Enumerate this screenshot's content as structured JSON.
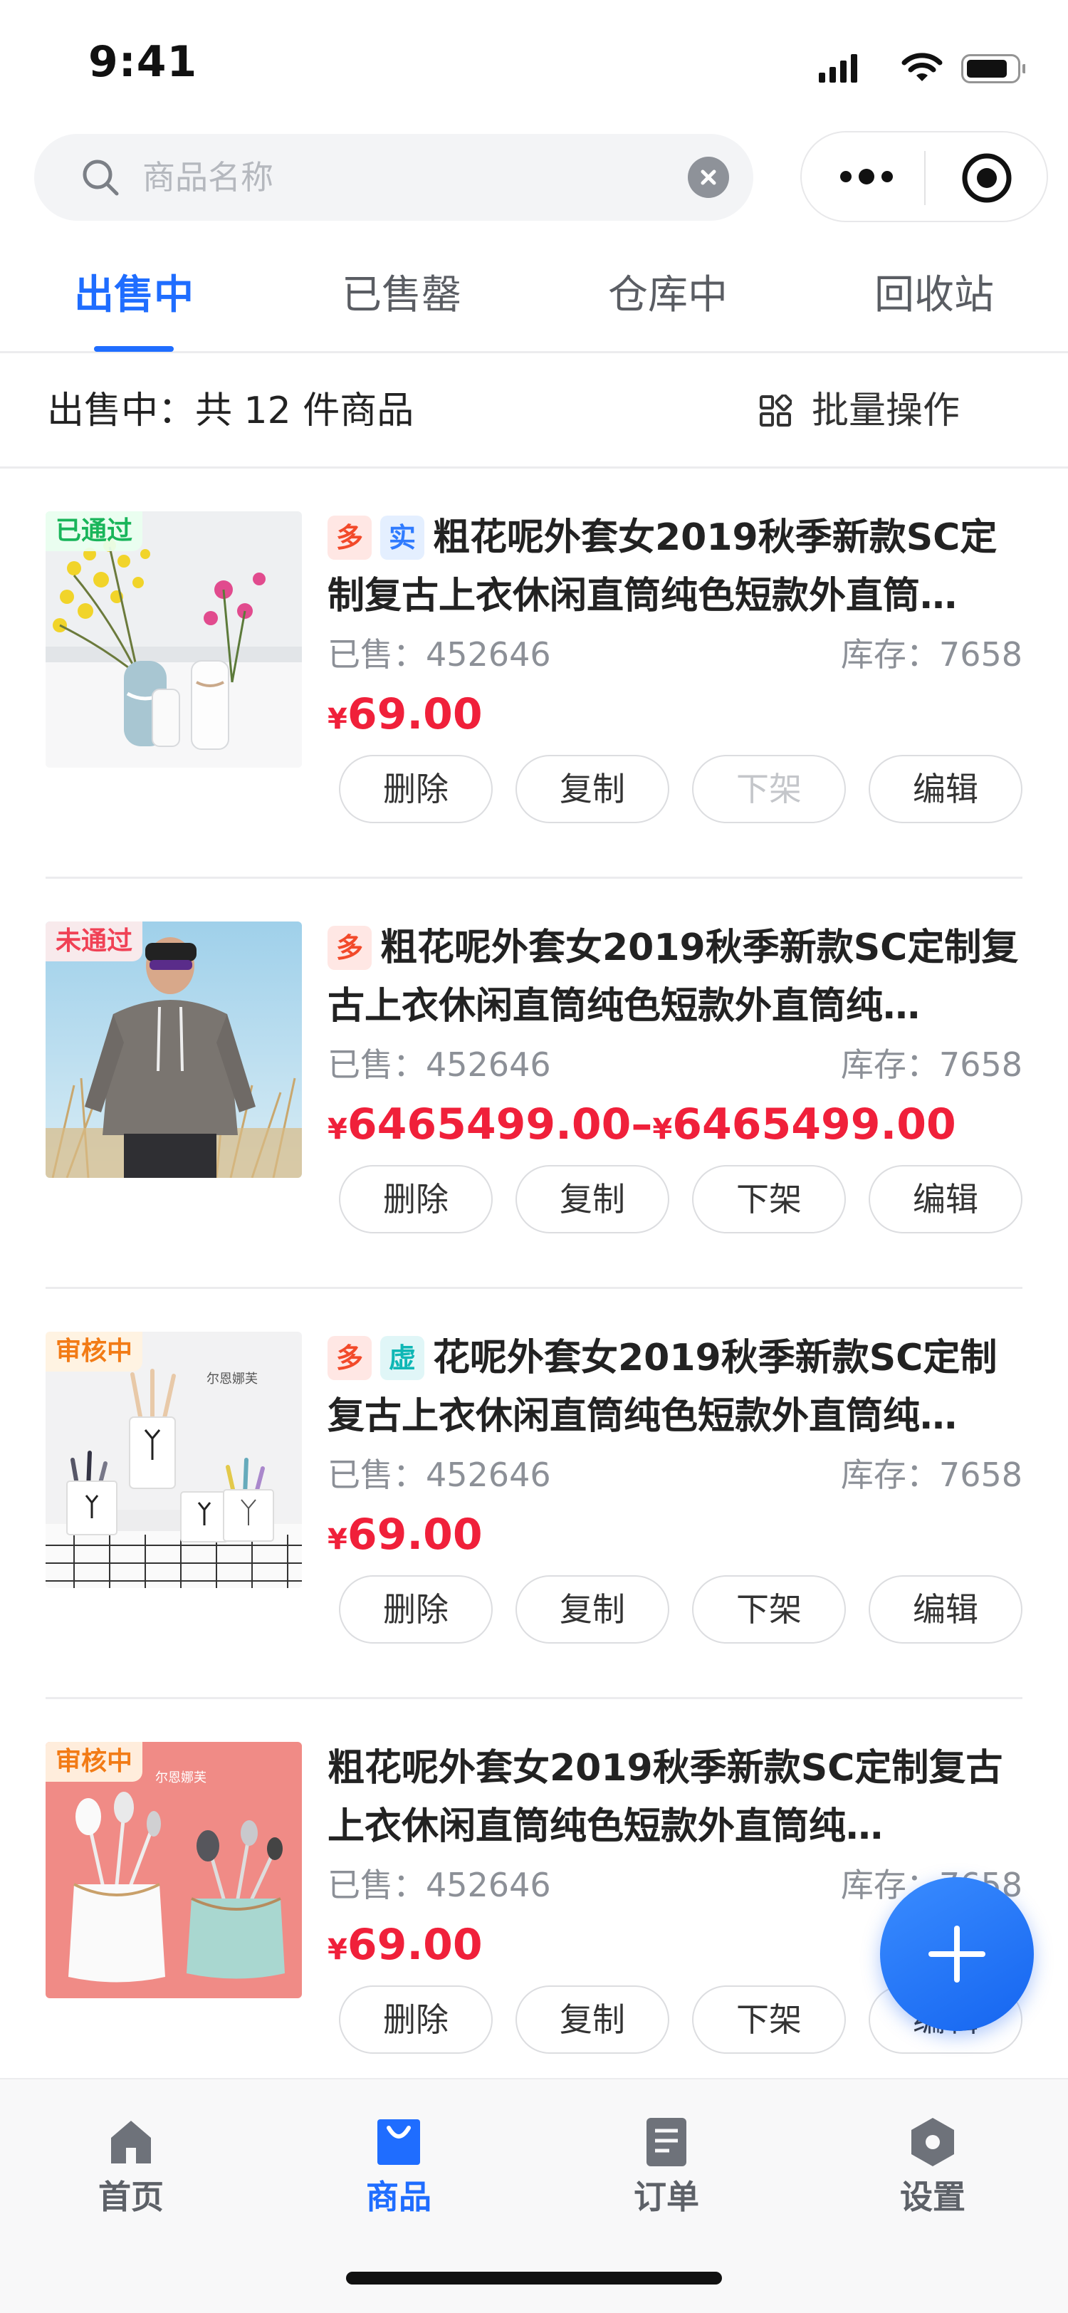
{
  "status_bar": {
    "time": "9:41"
  },
  "search": {
    "placeholder": "商品名称"
  },
  "tabs": [
    {
      "label": "出售中",
      "active": true
    },
    {
      "label": "已售罄",
      "active": false
    },
    {
      "label": "仓库中",
      "active": false
    },
    {
      "label": "回收站",
      "active": false
    }
  ],
  "summary": {
    "text": "出售中：共 12 件商品",
    "batch_label": "批量操作"
  },
  "items": [
    {
      "badge": "已通过",
      "badge_type": "pass",
      "tags": [
        {
          "text": "多",
          "type": "duo"
        },
        {
          "text": "实",
          "type": "shi"
        }
      ],
      "title": "粗花呢外套女2019秋季新款SC定制复古上衣休闲直筒纯色短款外直筒…",
      "sold": "已售：452646",
      "stock": "库存：7658",
      "price_symbol": "¥",
      "price": "69.00",
      "buttons": [
        {
          "label": "删除",
          "disabled": false
        },
        {
          "label": "复制",
          "disabled": false
        },
        {
          "label": "下架",
          "disabled": true
        },
        {
          "label": "编辑",
          "disabled": false
        }
      ]
    },
    {
      "badge": "未通过",
      "badge_type": "fail",
      "tags": [
        {
          "text": "多",
          "type": "duo"
        }
      ],
      "title": "粗花呢外套女2019秋季新款SC定制复古上衣休闲直筒纯色短款外直筒纯…",
      "sold": "已售：452646",
      "stock": "库存：7658",
      "price_symbol": "¥",
      "price": "6465499.00",
      "price_sep": "–",
      "price_symbol_2": "¥",
      "price_max": "6465499.00",
      "buttons": [
        {
          "label": "删除",
          "disabled": false
        },
        {
          "label": "复制",
          "disabled": false
        },
        {
          "label": "下架",
          "disabled": false
        },
        {
          "label": "编辑",
          "disabled": false
        }
      ]
    },
    {
      "badge": "审核中",
      "badge_type": "review",
      "tags": [
        {
          "text": "多",
          "type": "duo"
        },
        {
          "text": "虚",
          "type": "xu"
        }
      ],
      "title": "花呢外套女2019秋季新款SC定制复古上衣休闲直筒纯色短款外直筒纯…",
      "image_text": "尔恩娜芙",
      "sold": "已售：452646",
      "stock": "库存：7658",
      "price_symbol": "¥",
      "price": "69.00",
      "buttons": [
        {
          "label": "删除",
          "disabled": false
        },
        {
          "label": "复制",
          "disabled": false
        },
        {
          "label": "下架",
          "disabled": false
        },
        {
          "label": "编辑",
          "disabled": false
        }
      ]
    },
    {
      "badge": "审核中",
      "badge_type": "review",
      "tags": [],
      "title": "粗花呢外套女2019秋季新款SC定制复古上衣休闲直筒纯色短款外直筒纯…",
      "image_text": "尔恩娜芙",
      "sold": "已售：452646",
      "stock": "库存：7658",
      "price_symbol": "¥",
      "price": "69.00",
      "buttons": [
        {
          "label": "删除",
          "disabled": false
        },
        {
          "label": "复制",
          "disabled": false
        },
        {
          "label": "下架",
          "disabled": false
        },
        {
          "label": "编辑",
          "disabled": false
        }
      ]
    }
  ],
  "nav": [
    {
      "label": "首页",
      "icon": "home-icon",
      "active": false
    },
    {
      "label": "商品",
      "icon": "bag-icon",
      "active": true
    },
    {
      "label": "订单",
      "icon": "order-icon",
      "active": false
    },
    {
      "label": "设置",
      "icon": "settings-icon",
      "active": false
    }
  ],
  "colors": {
    "accent": "#1f6dff",
    "price": "#f0203a"
  }
}
